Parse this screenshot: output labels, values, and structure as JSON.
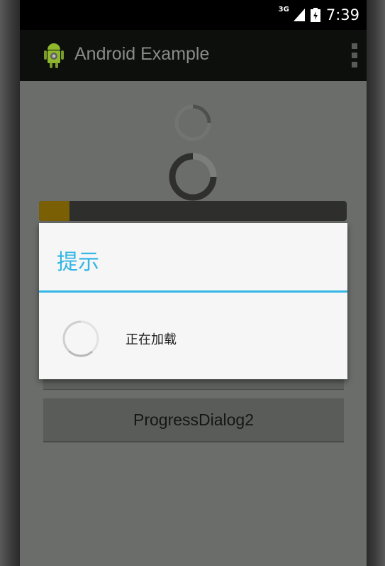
{
  "status_bar": {
    "network": "3G",
    "time": "7:39"
  },
  "action_bar": {
    "title": "Android Example"
  },
  "progress": {
    "horizontal_value_percent": 10
  },
  "buttons": {
    "progress_dialog2": "ProgressDialog2"
  },
  "dialog": {
    "title": "提示",
    "message": "正在加载"
  },
  "colors": {
    "accent": "#33b5e5",
    "progress_fill": "#7a5f04"
  },
  "icons": [
    "android-app-icon",
    "overflow-menu-icon",
    "signal-icon",
    "battery-icon",
    "spinner-icon"
  ]
}
